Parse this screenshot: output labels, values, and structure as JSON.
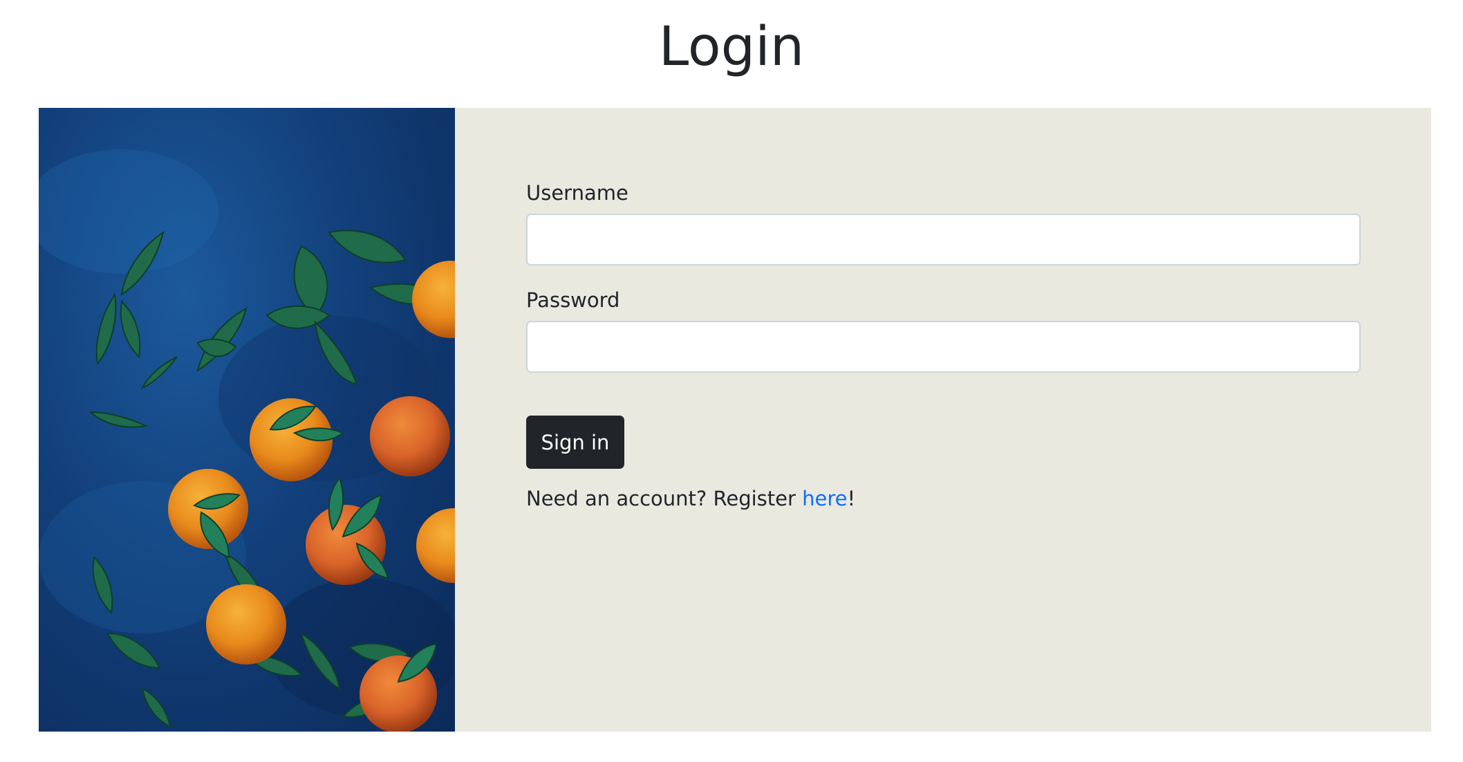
{
  "page": {
    "title": "Login"
  },
  "form": {
    "username_label": "Username",
    "username_value": "",
    "password_label": "Password",
    "password_value": "",
    "submit_label": "Sign in",
    "register_prefix": "Need an account? Register ",
    "register_link": "here",
    "register_suffix": "!"
  },
  "colors": {
    "panel_background": "#e9e9e0",
    "button_background": "#212529",
    "link": "#0d6efd",
    "photo_background": "#123f7a"
  }
}
